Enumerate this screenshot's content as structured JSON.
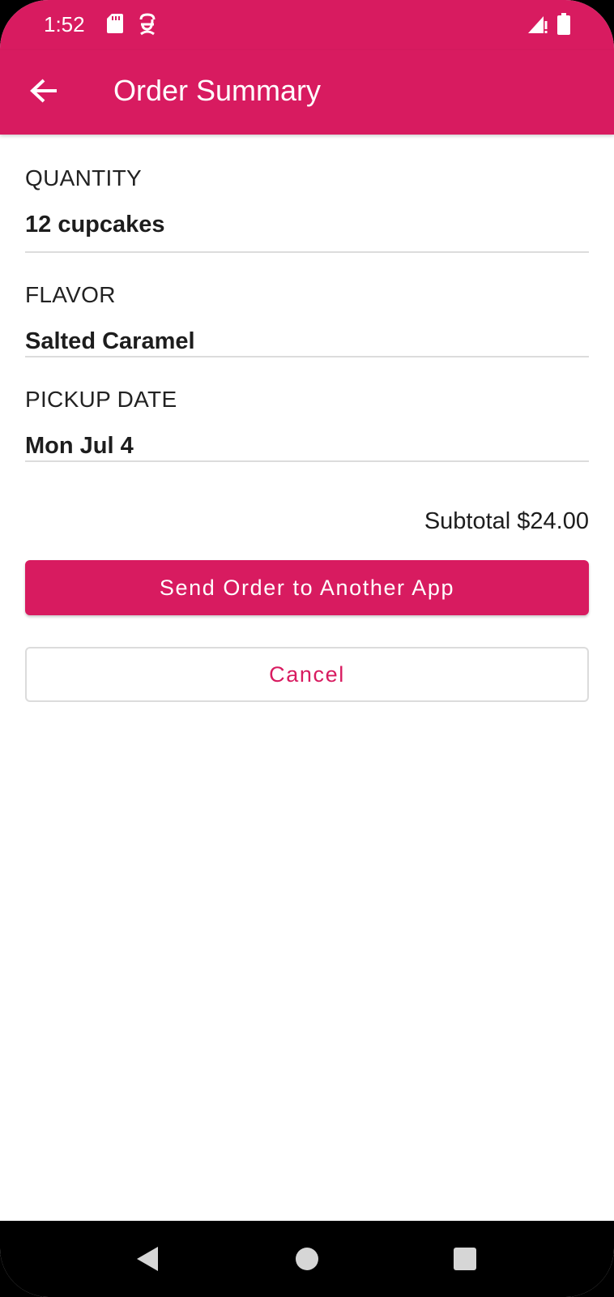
{
  "status_bar": {
    "time": "1:52",
    "icons": [
      "sd-card-icon",
      "app-notification-icon",
      "signal-icon",
      "battery-icon"
    ]
  },
  "app_bar": {
    "title": "Order Summary",
    "back_icon": "arrow-back-icon"
  },
  "order": {
    "fields": [
      {
        "label": "QUANTITY",
        "value": "12 cupcakes"
      },
      {
        "label": "FLAVOR",
        "value": "Salted Caramel"
      },
      {
        "label": "PICKUP DATE",
        "value": "Mon Jul 4"
      }
    ],
    "subtotal": "Subtotal $24.00"
  },
  "actions": {
    "send_label": "Send Order to Another App",
    "cancel_label": "Cancel"
  },
  "nav_bar": {
    "icons": [
      "back-triangle-icon",
      "home-circle-icon",
      "recents-square-icon"
    ]
  },
  "colors": {
    "primary": "#D81B60",
    "on_primary": "#FFFFFF",
    "text": "#1D1D1D",
    "divider": "#DCDCDC"
  }
}
